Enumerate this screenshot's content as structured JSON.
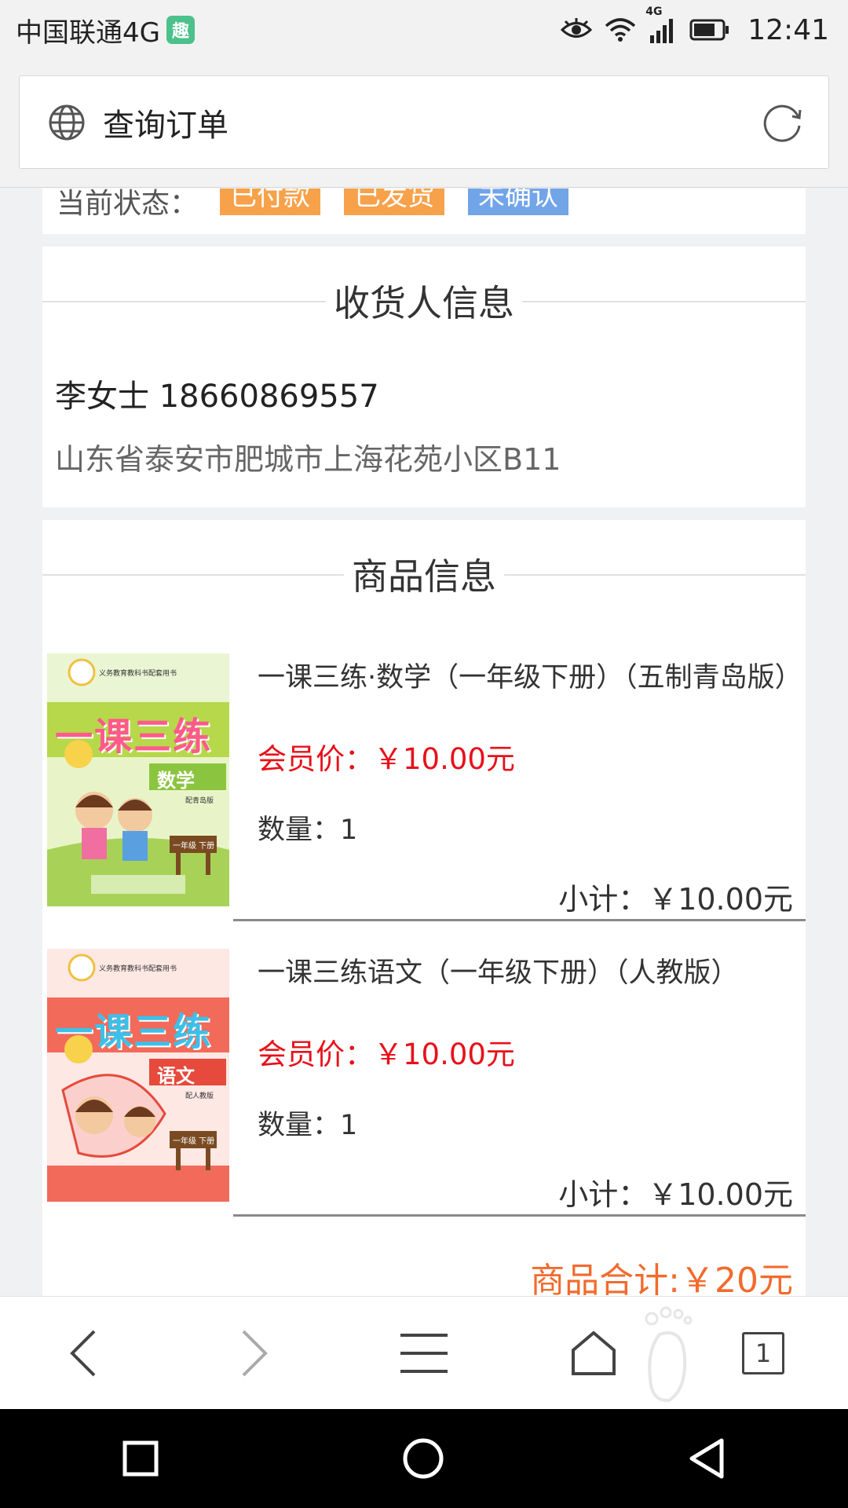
{
  "status_bar": {
    "carrier": "中国联通4G",
    "carrier_badge": "趣",
    "network_badge": "4G",
    "time": "12:41",
    "icons": [
      "eye-icon",
      "wifi-icon",
      "signal-icon",
      "battery-icon"
    ]
  },
  "address_bar": {
    "title": "查询订单",
    "icons": [
      "globe-icon",
      "refresh-icon"
    ]
  },
  "order_status": {
    "label": "当前状态：",
    "tags": [
      "已付款",
      "已发货",
      "未确认"
    ]
  },
  "receiver": {
    "heading": "收货人信息",
    "name_phone": "李女士 18660869557",
    "address": "山东省泰安市肥城市上海花苑小区B11"
  },
  "goods": {
    "heading": "商品信息",
    "items": [
      {
        "name": "一课三练·数学（一年级下册）（五制青岛版）",
        "price": "会员价：￥10.00元",
        "quantity": "数量：1",
        "subtotal": "小计：￥10.00元",
        "cover": {
          "title": "一课三练",
          "subject": "数学",
          "edition": "配青岛版",
          "grade": "一年级 下册",
          "series": "义务教育教科书配套用书"
        }
      },
      {
        "name": "一课三练语文（一年级下册）（人教版）",
        "price": "会员价：￥10.00元",
        "quantity": "数量：1",
        "subtotal": "小计：￥10.00元",
        "cover": {
          "title": "一课三练",
          "subject": "语文",
          "edition": "配人教版",
          "grade": "一年级 下册",
          "series": "义务教育教科书配套用书"
        }
      }
    ],
    "total": "商品合计:￥20元"
  },
  "toolbar": {
    "tab_count": "1",
    "buttons": [
      "back-icon",
      "forward-icon",
      "menu-icon",
      "home-icon",
      "tabs-icon"
    ]
  },
  "colors": {
    "price_red": "#e8101a",
    "total_orange": "#f26b2d",
    "tag_orange": "#f7a24b",
    "tag_blue": "#72a4e8"
  }
}
